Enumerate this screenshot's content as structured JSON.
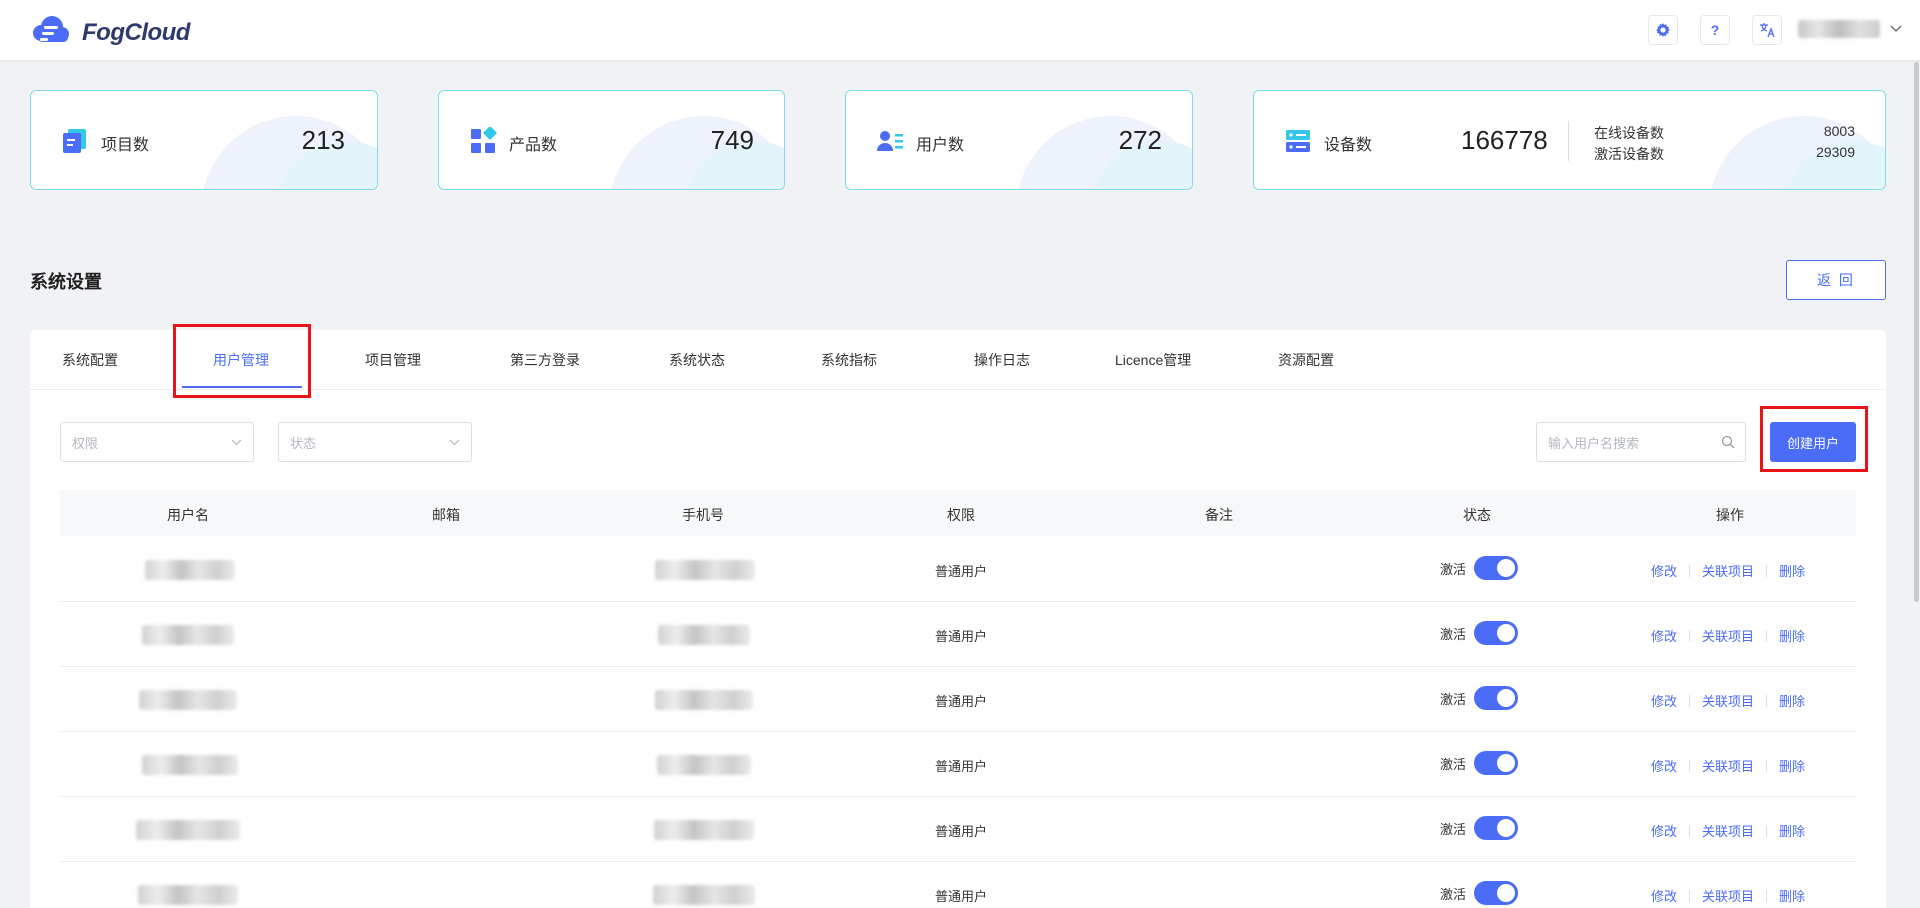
{
  "app": {
    "brand": "FogCloud"
  },
  "header": {
    "help_label": "?"
  },
  "stats": [
    {
      "label": "项目数",
      "value": "213"
    },
    {
      "label": "产品数",
      "value": "749"
    },
    {
      "label": "用户数",
      "value": "272"
    },
    {
      "label": "设备数",
      "value": "166778",
      "online_label": "在线设备数",
      "online_value": "8003",
      "active_label": "激活设备数",
      "active_value": "29309"
    }
  ],
  "section": {
    "title": "系统设置",
    "back_label": "返 回"
  },
  "tabs": [
    {
      "label": "系统配置",
      "active": false
    },
    {
      "label": "用户管理",
      "active": true
    },
    {
      "label": "项目管理",
      "active": false
    },
    {
      "label": "第三方登录",
      "active": false
    },
    {
      "label": "系统状态",
      "active": false
    },
    {
      "label": "系统指标",
      "active": false
    },
    {
      "label": "操作日志",
      "active": false
    },
    {
      "label": "Licence管理",
      "active": false
    },
    {
      "label": "资源配置",
      "active": false
    }
  ],
  "filters": {
    "permission_placeholder": "权限",
    "status_placeholder": "状态",
    "search_placeholder": "输入用户名搜索",
    "create_label": "创建用户"
  },
  "table": {
    "columns": [
      "用户名",
      "邮箱",
      "手机号",
      "权限",
      "备注",
      "状态",
      "操作"
    ],
    "rows": [
      {
        "permission": "普通用户",
        "status": "激活",
        "enabled": true
      },
      {
        "permission": "普通用户",
        "status": "激活",
        "enabled": true
      },
      {
        "permission": "普通用户",
        "status": "激活",
        "enabled": true
      },
      {
        "permission": "普通用户",
        "status": "激活",
        "enabled": true
      },
      {
        "permission": "普通用户",
        "status": "激活",
        "enabled": true
      },
      {
        "permission": "普通用户",
        "status": "激活",
        "enabled": true
      }
    ],
    "actions": {
      "edit": "修改",
      "link": "关联项目",
      "delete": "删除"
    }
  },
  "colors": {
    "accent": "#4a6cf7",
    "highlight": "#e8141a",
    "card_border": "#7fdbe6"
  }
}
